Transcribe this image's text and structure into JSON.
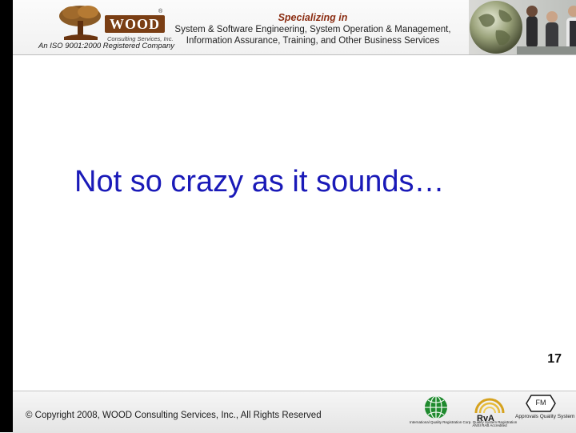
{
  "logo": {
    "word": "WOOD",
    "registered_mark": "®",
    "company": "Consulting Services, Inc.",
    "iso_line": "An ISO 9001:2000 Registered Company"
  },
  "tagline": {
    "heading": "Specializing in",
    "line1": "System & Software Engineering, System Operation & Management,",
    "line2": "Information Assurance, Training, and Other Business Services"
  },
  "slide": {
    "title": "Not so crazy as it sounds…",
    "page_number": "17"
  },
  "footer": {
    "copyright": "© Copyright 2008, WOOD Consulting Services, Inc., All Rights Reserved",
    "certs": [
      {
        "label": "International Quality Registration Corp. Quality System Registration"
      },
      {
        "label": "ANSI RAB Accredited"
      },
      {
        "mark": "FM",
        "label": "Approvals Quality System Registration"
      }
    ]
  },
  "colors": {
    "title": "#1a1ab8",
    "left_bar": "#000000",
    "tagline_heading": "#8b2d12",
    "logo_brown": "#7a3e14"
  },
  "icons": [
    "tree-logo-icon",
    "globe-icon",
    "iqrc-globe-icon",
    "ansi-rab-icon",
    "fm-approvals-icon"
  ]
}
